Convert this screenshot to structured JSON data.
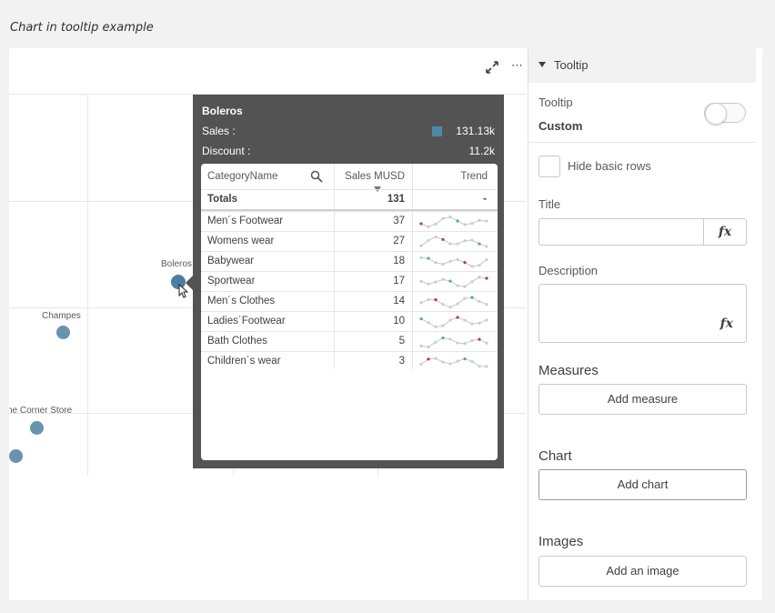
{
  "caption": "Chart in tooltip example",
  "chart": {
    "bubbles": [
      {
        "label": "Boleros"
      },
      {
        "label": "Champes"
      },
      {
        "label": "ne Corner Store"
      },
      {
        "label": ""
      }
    ]
  },
  "tooltip": {
    "title": "Boleros",
    "sales_label": "Sales :",
    "sales_value": "131.13k",
    "discount_label": "Discount :",
    "discount_value": "11.2k",
    "swatch_color": "#4a8aa8",
    "table": {
      "headers": [
        "CategoryName",
        "Sales MUSD",
        "Trend"
      ],
      "totals": {
        "label": "Totals",
        "value": "131",
        "trend": "-"
      },
      "rows": [
        {
          "name": "Men´s Footwear",
          "value": "37"
        },
        {
          "name": "Womens wear",
          "value": "27"
        },
        {
          "name": "Babywear",
          "value": "18"
        },
        {
          "name": "Sportwear",
          "value": "17"
        },
        {
          "name": "Men´s Clothes",
          "value": "14"
        },
        {
          "name": "Ladies´Footwear",
          "value": "10"
        },
        {
          "name": "Bath Clothes",
          "value": "5"
        },
        {
          "name": "Children´s wear",
          "value": "3"
        }
      ]
    }
  },
  "panel": {
    "header": "Tooltip",
    "tooltip_label": "Tooltip",
    "tooltip_mode": "Custom",
    "hide_basic_rows": "Hide basic rows",
    "title_label": "Title",
    "title_value": "",
    "description_label": "Description",
    "description_value": "",
    "fx": "fx",
    "measures_label": "Measures",
    "add_measure": "Add measure",
    "chart_label": "Chart",
    "add_chart": "Add chart",
    "images_label": "Images",
    "add_image": "Add an image"
  }
}
